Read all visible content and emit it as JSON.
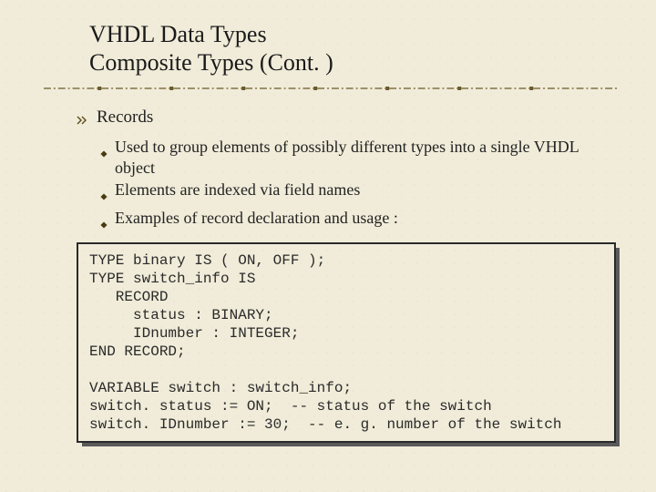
{
  "title_line1": "VHDL Data Types",
  "title_line2": "Composite Types (Cont. )",
  "content": {
    "records_label": "Records",
    "sub1": "Used to group elements of possibly different types into a single VHDL object",
    "sub2": "Elements are indexed via field names",
    "sub3": "Examples of record declaration and usage :"
  },
  "code": "TYPE binary IS ( ON, OFF );\nTYPE switch_info IS\n   RECORD\n     status : BINARY;\n     IDnumber : INTEGER;\nEND RECORD;\n\nVARIABLE switch : switch_info;\nswitch. status := ON;  -- status of the switch\nswitch. IDnumber := 30;  -- e. g. number of the switch"
}
